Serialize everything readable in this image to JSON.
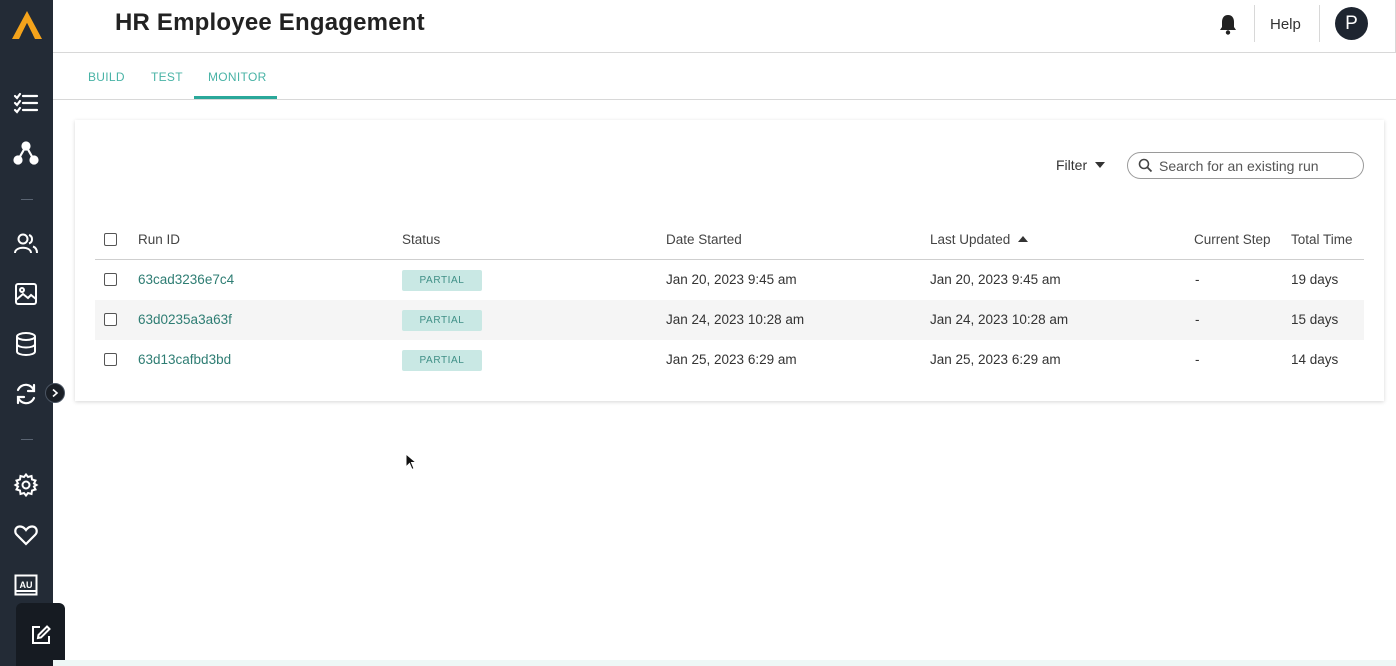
{
  "header": {
    "title": "HR Employee Engagement",
    "help_label": "Help",
    "avatar_initial": "P"
  },
  "tabs": [
    {
      "label": "BUILD"
    },
    {
      "label": "TEST"
    },
    {
      "label": "MONITOR",
      "active": true
    }
  ],
  "toolbar": {
    "filter_label": "Filter",
    "search_placeholder": "Search for an existing run"
  },
  "table": {
    "columns": [
      "Run ID",
      "Status",
      "Date Started",
      "Last Updated",
      "Current Step",
      "Total Time"
    ],
    "sorted_column": "Last Updated",
    "sort_direction": "ascending",
    "rows": [
      {
        "run_id": "63cad3236e7c4",
        "status": "PARTIAL",
        "date_started": "Jan 20, 2023 9:45 am",
        "last_updated": "Jan 20, 2023 9:45 am",
        "current_step": "-",
        "total_time": "19 days"
      },
      {
        "run_id": "63d0235a3a63f",
        "status": "PARTIAL",
        "date_started": "Jan 24, 2023 10:28 am",
        "last_updated": "Jan 24, 2023 10:28 am",
        "current_step": "-",
        "total_time": "15 days"
      },
      {
        "run_id": "63d13cafbd3bd",
        "status": "PARTIAL",
        "date_started": "Jan 25, 2023 6:29 am",
        "last_updated": "Jan 25, 2023 6:29 am",
        "current_step": "-",
        "total_time": "14 days"
      }
    ]
  },
  "sidebar": {
    "icons": [
      "checklist-icon",
      "nodes-icon",
      "users-icon",
      "image-icon",
      "database-icon",
      "sync-icon",
      "settings-icon",
      "heart-icon",
      "au-icon",
      "edit-icon"
    ],
    "au_text": "AU"
  },
  "colors": {
    "accent": "#2aa89a",
    "sidebar_bg": "#232b36",
    "logo": "#f4a31b",
    "badge_bg": "#c9e8e4"
  }
}
